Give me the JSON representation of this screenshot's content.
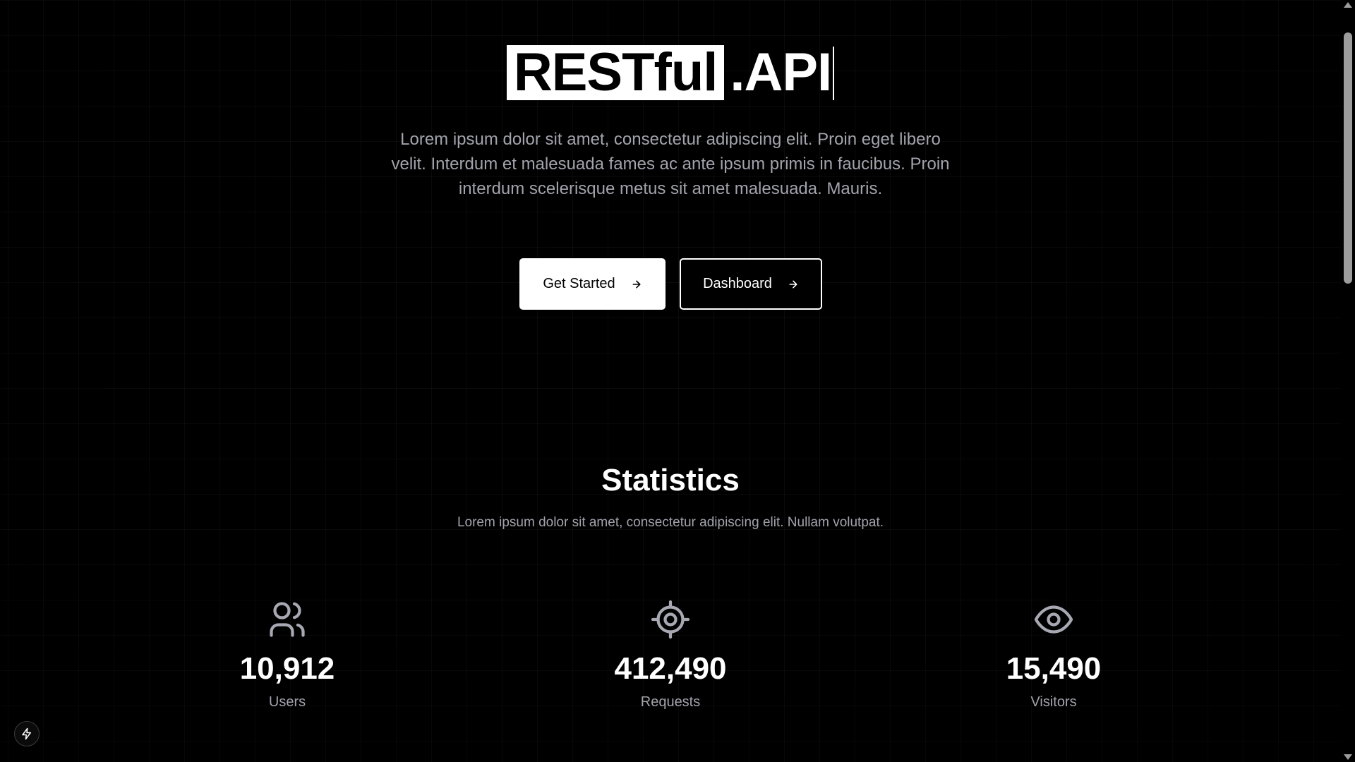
{
  "hero": {
    "title_highlight": "RESTful",
    "title_suffix": ".API",
    "description": "Lorem ipsum dolor sit amet, consectetur adipiscing elit. Proin eget libero velit. Interdum et malesuada fames ac ante ipsum primis in faucibus. Proin interdum scelerisque metus sit amet malesuada. Mauris.",
    "buttons": {
      "primary_label": "Get Started",
      "secondary_label": "Dashboard"
    }
  },
  "statistics": {
    "title": "Statistics",
    "description": "Lorem ipsum dolor sit amet, consectetur adipiscing elit. Nullam volutpat.",
    "items": [
      {
        "icon": "users-icon",
        "value": "10,912",
        "label": "Users"
      },
      {
        "icon": "target-icon",
        "value": "412,490",
        "label": "Requests"
      },
      {
        "icon": "eye-icon",
        "value": "15,490",
        "label": "Visitors"
      }
    ]
  },
  "colors": {
    "background": "#000000",
    "foreground": "#ffffff",
    "muted_text": "#a3a3ad",
    "icon": "#a8a8b3"
  },
  "floating_button": {
    "icon": "bolt-icon"
  }
}
